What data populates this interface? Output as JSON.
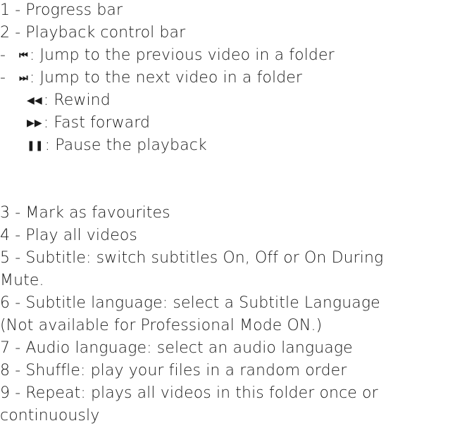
{
  "items": [
    {
      "text": "1 -  Progress bar"
    },
    {
      "text": "2 -  Playback control bar"
    },
    {
      "prefix": "-",
      "icon_name": "previous-track-icon",
      "icon": "⏮",
      "text": ": Jump to the previous video in a folder"
    },
    {
      "prefix": "-",
      "icon_name": "next-track-icon",
      "icon": "⏭",
      "text": ": Jump to the next video in a folder"
    },
    {
      "icon_name": "rewind-icon",
      "icon": "◀◀",
      "text": ": Rewind"
    },
    {
      "icon_name": "fast-forward-icon",
      "icon": "▶▶",
      "text": ": Fast forward"
    },
    {
      "icon_name": "pause-icon",
      "icon": "❚❚",
      "text": ": Pause the playback"
    },
    {
      "text": "3 -  Mark as favourites"
    },
    {
      "text": "4 -  Play all videos"
    },
    {
      "text": "5 -  Subtitle: switch subtitles On, Off or On During"
    },
    {
      "text": "Mute."
    },
    {
      "text": "6 -  Subtitle language: select a Subtitle Language"
    },
    {
      "text": "(Not available for Professional Mode ON.)"
    },
    {
      "text": "7 -  Audio language: select an audio language"
    },
    {
      "text": "8 -  Shuffle: play your files in a random order"
    },
    {
      "text": "9 -  Repeat: plays all videos in this folder once or"
    },
    {
      "text": "continuously"
    }
  ]
}
